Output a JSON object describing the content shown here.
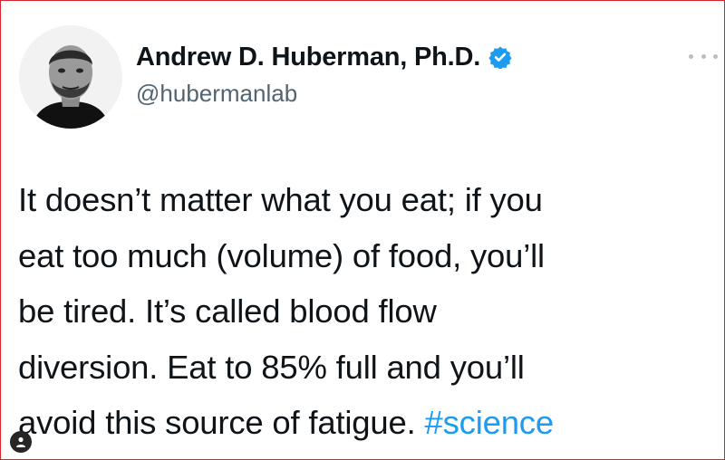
{
  "author": {
    "display_name": "Andrew D. Huberman, Ph.D.",
    "handle": "@hubermanlab",
    "verified": true,
    "avatar_icon": "profile-photo",
    "verified_icon": "verified-badge-icon"
  },
  "menu": {
    "icon": "more-options-icon"
  },
  "tweet": {
    "lines": [
      "It doesn’t matter what you eat; if you",
      "eat too much (volume) of food, you’ll",
      "be tired. It’s called blood flow",
      "diversion. Eat to 85% full and you’ll",
      "avoid this source of fatigue. "
    ],
    "hashtag": "#science"
  },
  "overlay": {
    "icon": "user-account-icon"
  },
  "colors": {
    "text": "#0f1419",
    "secondary": "#536471",
    "link": "#1d9bf0",
    "verified": "#1d9bf0",
    "frame_border": "#d6242e"
  }
}
